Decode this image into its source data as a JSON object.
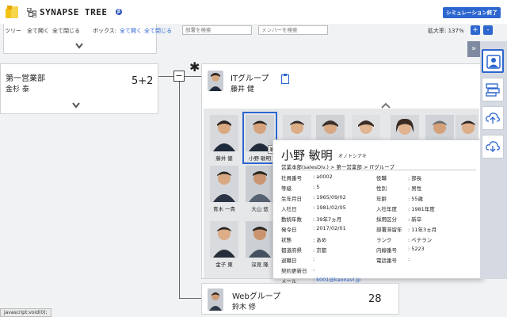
{
  "header": {
    "app_title": "SYNAPSE TREE",
    "badge": "β",
    "end_button": "シミュレーション終了"
  },
  "toolbar": {
    "tree_label": "ツリー",
    "tree_open": "全て開く",
    "tree_close": "全て閉じる",
    "box_label": "ボックス:",
    "box_open": "全て開く",
    "box_close": "全て閉じる",
    "dept_search_placeholder": "部署を検索",
    "member_search_placeholder": "メンバーを検索",
    "zoom_label": "拡大率: 137%",
    "zoom_in": "+",
    "zoom_out": "-"
  },
  "tree": {
    "sales": {
      "title": "第一営業部",
      "manager": "金杉 泰",
      "count": "5+2"
    },
    "it": {
      "title": "ITグループ",
      "manager": "藤井 健"
    },
    "web": {
      "title": "Webグループ",
      "manager": "鈴木 修",
      "count": "28"
    },
    "asterisk": "✱",
    "collapse_symbol": "−"
  },
  "members": [
    {
      "name": "藤井 健"
    },
    {
      "name": "小野 敏明",
      "badge": "兼"
    },
    {
      "name": ""
    },
    {
      "name": ""
    },
    {
      "name": ""
    },
    {
      "name": ""
    },
    {
      "name": ""
    },
    {
      "name": ""
    },
    {
      "name": "青木 一貴"
    },
    {
      "name": "大山 悠"
    },
    {
      "name": "金子 東"
    },
    {
      "name": "深見 隆"
    }
  ],
  "detail": {
    "name": "小野 敏明",
    "kana": "オノトシアキ",
    "path": "営業本部(salesDiv.) > 第一営業部 > ITグループ",
    "left": [
      {
        "k": "社員番号",
        "v": ": a0002"
      },
      {
        "k": "等級",
        "v": ": 5"
      },
      {
        "k": "生年月日",
        "v": ": 1965/09/02"
      },
      {
        "k": "入社日",
        "v": ": 1981/02/05"
      },
      {
        "k": "勤続年数",
        "v": ": 39年7ヵ月"
      },
      {
        "k": "発令日",
        "v": ": 2017/02/01"
      },
      {
        "k": "状態",
        "v": ": あめ"
      },
      {
        "k": "都道府県",
        "v": ": 京都"
      },
      {
        "k": "退職日",
        "v": ":"
      },
      {
        "k": "契約更新日",
        "v": ":"
      },
      {
        "k": "メール",
        "v": ": k001@kaonavi.jp"
      }
    ],
    "right": [
      {
        "k": "役職",
        "v": ": 部長"
      },
      {
        "k": "性別",
        "v": ": 男性"
      },
      {
        "k": "年齢",
        "v": ": 55歳"
      },
      {
        "k": "入社年度",
        "v": ": 1981年度"
      },
      {
        "k": "採用区分",
        "v": ": 新卒"
      },
      {
        "k": "部署滞留年",
        "v": ": 11年3ヵ月"
      },
      {
        "k": "ランク",
        "v": ": ベテラン"
      },
      {
        "k": "内線番号",
        "v": ": 5223"
      },
      {
        "k": "電話番号",
        "v": ":"
      }
    ]
  },
  "status_bar": "javascript:void(0);",
  "colors": {
    "accent": "#2d66cf",
    "rail": "#7e8aa0"
  }
}
